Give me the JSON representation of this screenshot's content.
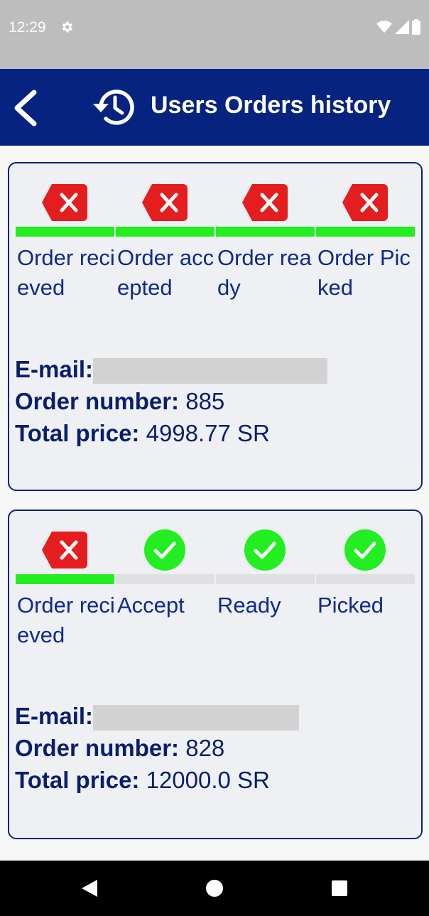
{
  "status_bar": {
    "time": "12:29"
  },
  "header": {
    "title": "Users Orders history"
  },
  "orders": [
    {
      "steps": [
        {
          "label": "Order recieved",
          "status": "cancel",
          "bar_on": true
        },
        {
          "label": "Order accepted",
          "status": "cancel",
          "bar_on": true
        },
        {
          "label": "Order ready",
          "status": "cancel",
          "bar_on": true
        },
        {
          "label": "Order Picked",
          "status": "cancel",
          "bar_on": true
        }
      ],
      "email_label": "E-mail:",
      "order_number_label": "Order number:",
      "order_number": "885",
      "total_price_label": "Total price:",
      "total_price": "4998.77 SR"
    },
    {
      "steps": [
        {
          "label": "Order recieved",
          "status": "cancel",
          "bar_on": true
        },
        {
          "label": "Accept",
          "status": "check",
          "bar_on": false
        },
        {
          "label": "Ready",
          "status": "check",
          "bar_on": false
        },
        {
          "label": "Picked",
          "status": "check",
          "bar_on": false
        }
      ],
      "email_label": "E-mail:",
      "order_number_label": "Order number:",
      "order_number": "828",
      "total_price_label": "Total price:",
      "total_price": "12000.0 SR"
    }
  ],
  "colors": {
    "app_bar": "#06237f",
    "cancel_red": "#e41e1e",
    "check_green": "#22ee22",
    "progress_on": "#22ee22"
  },
  "icons": {
    "back": "chevron-left-icon",
    "history": "history-icon",
    "cancel": "backspace-x-icon",
    "check": "check-circle-icon"
  }
}
